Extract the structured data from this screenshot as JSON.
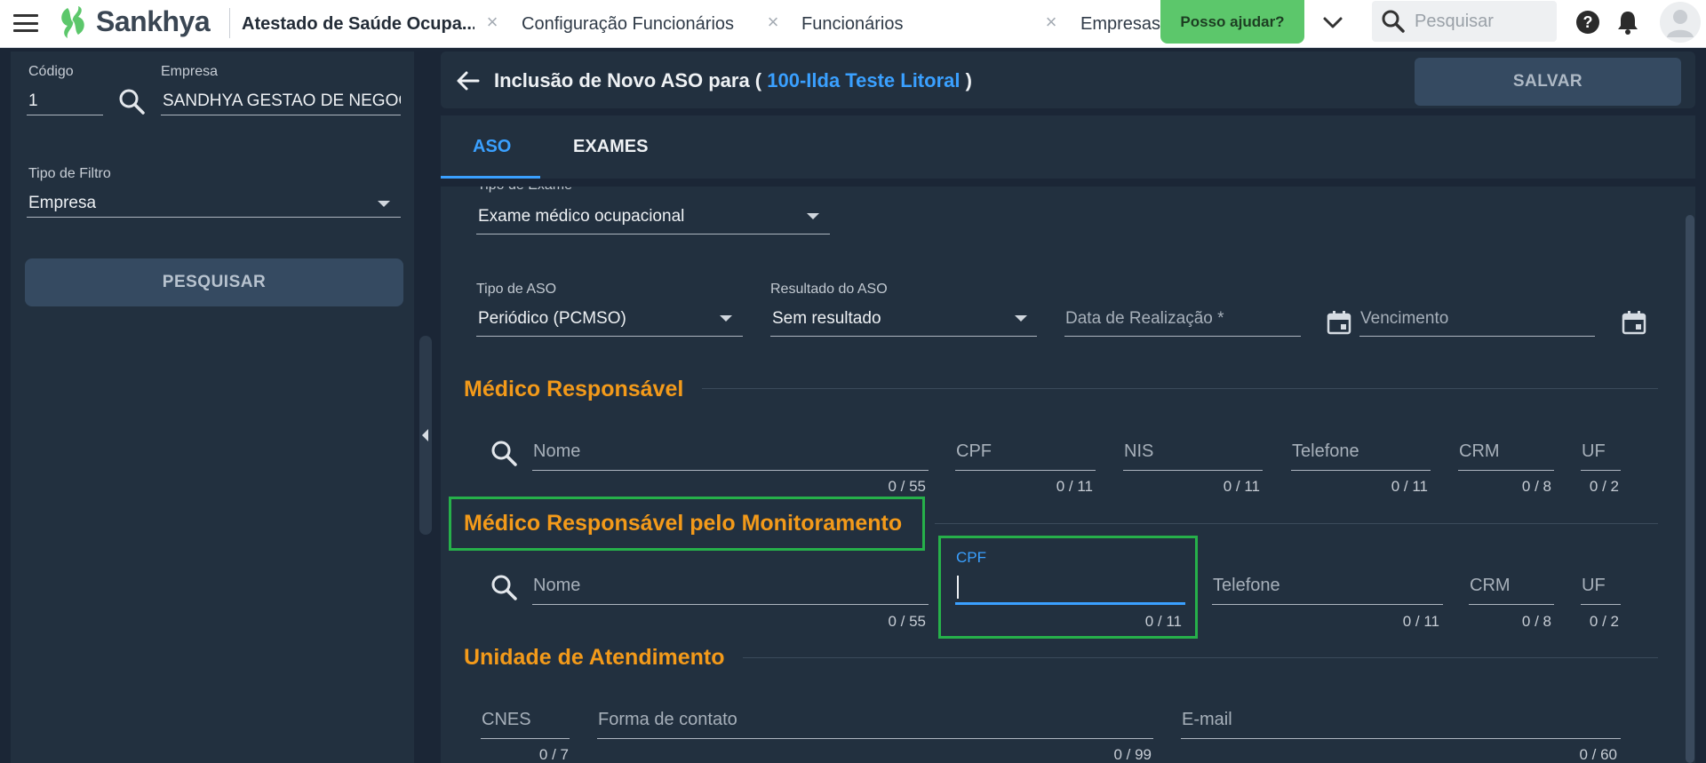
{
  "topbar": {
    "brand": "Sankhya",
    "tabs": [
      {
        "label": "Atestado de Saúde Ocupa...",
        "active": true
      },
      {
        "label": "Configuração Funcionários",
        "active": false
      },
      {
        "label": "Funcionários",
        "active": false
      },
      {
        "label": "Empresas",
        "active": false
      }
    ],
    "help_label": "Posso ajudar?",
    "search_placeholder": "Pesquisar",
    "icons": [
      "menu-icon",
      "chevron-down-icon",
      "search-icon",
      "help-icon",
      "bell-icon",
      "user-avatar-icon"
    ]
  },
  "left_panel": {
    "codigo_label": "Código",
    "codigo_value": "1",
    "empresa_label": "Empresa",
    "empresa_value": "SANDHYA GESTAO DE NEGOC",
    "tipo_filtro_label": "Tipo de Filtro",
    "tipo_filtro_value": "Empresa",
    "pesquisar_label": "PESQUISAR"
  },
  "header": {
    "title_prefix": "Inclusão de Novo ASO para (",
    "employee": "100-Ilda Teste Litoral",
    "title_suffix": ")",
    "salvar_label": "SALVAR"
  },
  "tabs": [
    {
      "label": "ASO",
      "active": true
    },
    {
      "label": "EXAMES",
      "active": false
    }
  ],
  "form": {
    "tipo_exame_label": "Tipo de Exame",
    "tipo_exame_value": "Exame médico ocupacional",
    "tipo_aso_label": "Tipo de ASO",
    "tipo_aso_value": "Periódico (PCMSO)",
    "resultado_label": "Resultado do ASO",
    "resultado_value": "Sem resultado",
    "data_realizacao_placeholder": "Data de Realização *",
    "vencimento_placeholder": "Vencimento",
    "medico_responsavel": {
      "title": "Médico Responsável",
      "nome": {
        "placeholder": "Nome",
        "counter": "0 / 55"
      },
      "cpf": {
        "placeholder": "CPF",
        "counter": "0 / 11"
      },
      "nis": {
        "placeholder": "NIS",
        "counter": "0 / 11"
      },
      "telefone": {
        "placeholder": "Telefone",
        "counter": "0 / 11"
      },
      "crm": {
        "placeholder": "CRM",
        "counter": "0 / 8"
      },
      "uf": {
        "placeholder": "UF",
        "counter": "0 / 2"
      }
    },
    "medico_monitoramento": {
      "title": "Médico Responsável pelo Monitoramento",
      "nome": {
        "placeholder": "Nome",
        "counter": "0 / 55"
      },
      "cpf": {
        "label": "CPF",
        "value": "",
        "counter": "0 / 11"
      },
      "telefone": {
        "placeholder": "Telefone",
        "counter": "0 / 11"
      },
      "crm": {
        "placeholder": "CRM",
        "counter": "0 / 8"
      },
      "uf": {
        "placeholder": "UF",
        "counter": "0 / 2"
      }
    },
    "unidade_atendimento": {
      "title": "Unidade de Atendimento",
      "cnes": {
        "placeholder": "CNES",
        "counter": "0 / 7"
      },
      "forma_contato": {
        "placeholder": "Forma de contato",
        "counter": "0 / 99"
      },
      "email": {
        "placeholder": "E-mail",
        "counter": "0 / 60"
      }
    }
  },
  "colors": {
    "background": "#1b2636",
    "panel": "#22303f",
    "accent_blue": "#3aa0ff",
    "section_orange": "#f39a1a",
    "highlight_green": "#26b04a",
    "help_green": "#5cc76b"
  }
}
